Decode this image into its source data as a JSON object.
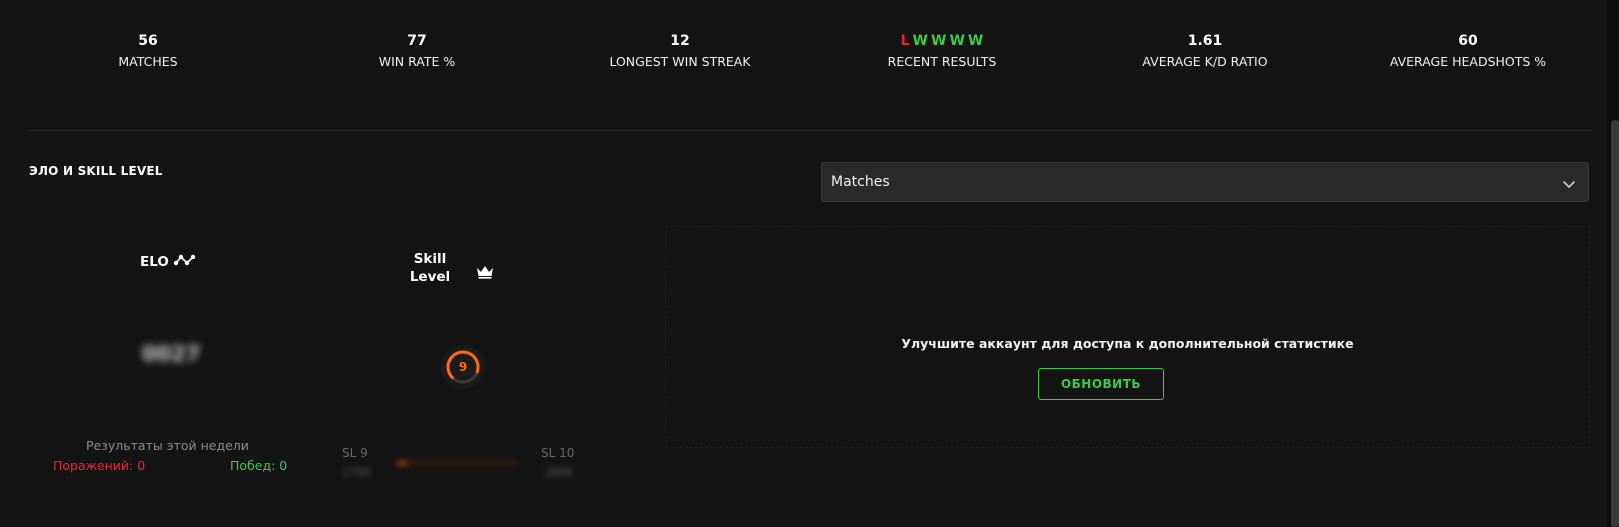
{
  "stats": [
    {
      "value": "56",
      "label": "MATCHES"
    },
    {
      "value": "77",
      "label": "WIN RATE %"
    },
    {
      "value": "12",
      "label": "LONGEST WIN STREAK"
    },
    {
      "label": "RECENT RESULTS",
      "results": [
        "L",
        "W",
        "W",
        "W",
        "W"
      ]
    },
    {
      "value": "1.61",
      "label": "AVERAGE K/D RATIO"
    },
    {
      "value": "60",
      "label": "AVERAGE HEADSHOTS %"
    }
  ],
  "section": {
    "title": "ЭЛО И SKILL LEVEL"
  },
  "dropdown": {
    "selected": "Matches"
  },
  "elo": {
    "label": "ELO",
    "value": "0027"
  },
  "skill": {
    "label_line1": "Skill",
    "label_line2": "Level",
    "level": "9",
    "current_label": "SL 9",
    "next_label": "SL 10",
    "range_min": "1750",
    "range_max": "2000",
    "progress_fraction": 0.1
  },
  "week": {
    "title": "Результаты этой недели",
    "losses": "Поражений: 0",
    "wins": "Побед: 0"
  },
  "upgrade": {
    "message": "Улучшите аккаунт для доступа к дополнительной статистике",
    "button_label": "ОБНОВИТЬ"
  },
  "colors": {
    "accent_green": "#3ec94a",
    "loss_red": "#e8243a",
    "level_orange": "#ff6a13",
    "background": "#141414"
  },
  "icons": {
    "elo": "elo-graph-icon",
    "skill": "crown-icon",
    "dropdown": "chevron-down-icon"
  }
}
